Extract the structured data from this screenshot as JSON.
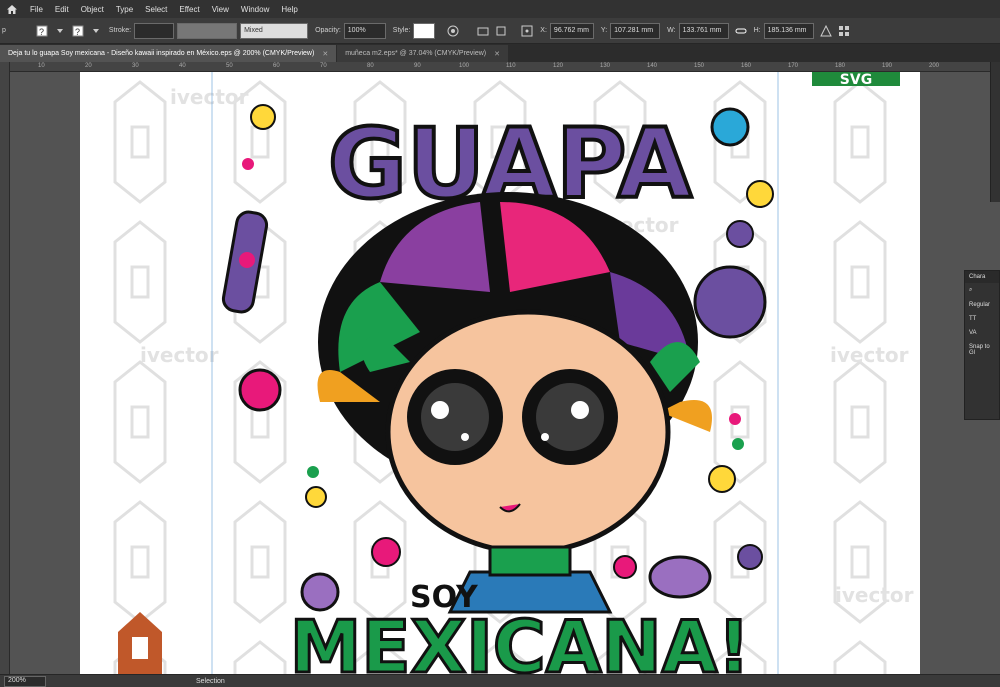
{
  "menubar": {
    "items": [
      "File",
      "Edit",
      "Object",
      "Type",
      "Select",
      "Effect",
      "View",
      "Window",
      "Help"
    ]
  },
  "controlbar": {
    "stroke_label": "Stroke:",
    "brush_value": "Mixed",
    "opacity_label": "Opacity:",
    "opacity_value": "100%",
    "style_label": "Style:",
    "x_label": "X:",
    "x_value": "96.762 mm",
    "y_label": "Y:",
    "y_value": "107.281 mm",
    "w_label": "W:",
    "w_value": "133.761 mm",
    "h_label": "H:",
    "h_value": "185.136 mm"
  },
  "tabs": [
    {
      "label": "Deja tu lo guapa Soy mexicana - Diseño kawaii inspirado en México.eps @ 200% (CMYK/Preview)",
      "active": true
    },
    {
      "label": "muñeca m2.eps* @ 37.04% (CMYK/Preview)",
      "active": false
    }
  ],
  "ruler": {
    "top_ticks": [
      "10",
      "20",
      "30",
      "40",
      "50",
      "60",
      "70",
      "80",
      "90",
      "100",
      "110",
      "120",
      "130",
      "140",
      "150",
      "160",
      "170",
      "180",
      "190",
      "200"
    ]
  },
  "artwork": {
    "headline": "GUAPA",
    "soy": "SOY",
    "mexicana": "MEXICANA!",
    "watermark": "ivector",
    "svg_badge": "SVG"
  },
  "char_panel": {
    "title": "Chara",
    "style": "Regular",
    "snap": "Snap to Gl"
  },
  "statusbar": {
    "zoom": "200%",
    "tool": "Selection"
  },
  "colors": {
    "purple": "#6b4fa0",
    "green": "#1a9a4a",
    "red": "#e52330",
    "pink": "#e8197a",
    "skin": "#f6c49e",
    "orange": "#f0a020"
  }
}
